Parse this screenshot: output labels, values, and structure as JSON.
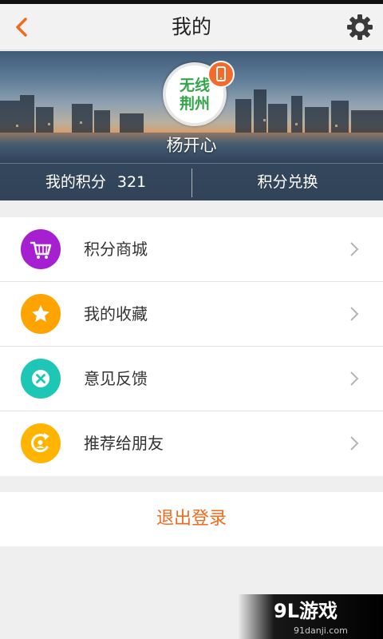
{
  "header": {
    "title": "我的",
    "back_icon": "chevron-left-icon",
    "settings_icon": "gear-icon",
    "accent": "#f26b1d"
  },
  "profile": {
    "avatar_logo_text": "无线荆州",
    "badge_icon": "phone-icon",
    "username": "杨开心",
    "points_label": "我的积分",
    "points_value": "321",
    "exchange_label": "积分兑换"
  },
  "menu": {
    "items": [
      {
        "label": "积分商城",
        "icon": "cart-icon",
        "color": "#a61fd0"
      },
      {
        "label": "我的收藏",
        "icon": "star-icon",
        "color": "#ffa300"
      },
      {
        "label": "意见反馈",
        "icon": "close-circle-icon",
        "color": "#1ec7b5"
      },
      {
        "label": "推荐给朋友",
        "icon": "share-arrow-icon",
        "color": "#ffb400"
      }
    ]
  },
  "logout": {
    "label": "退出登录"
  },
  "watermark": {
    "logo_text": "9L游戏",
    "url": "91danji.com"
  }
}
